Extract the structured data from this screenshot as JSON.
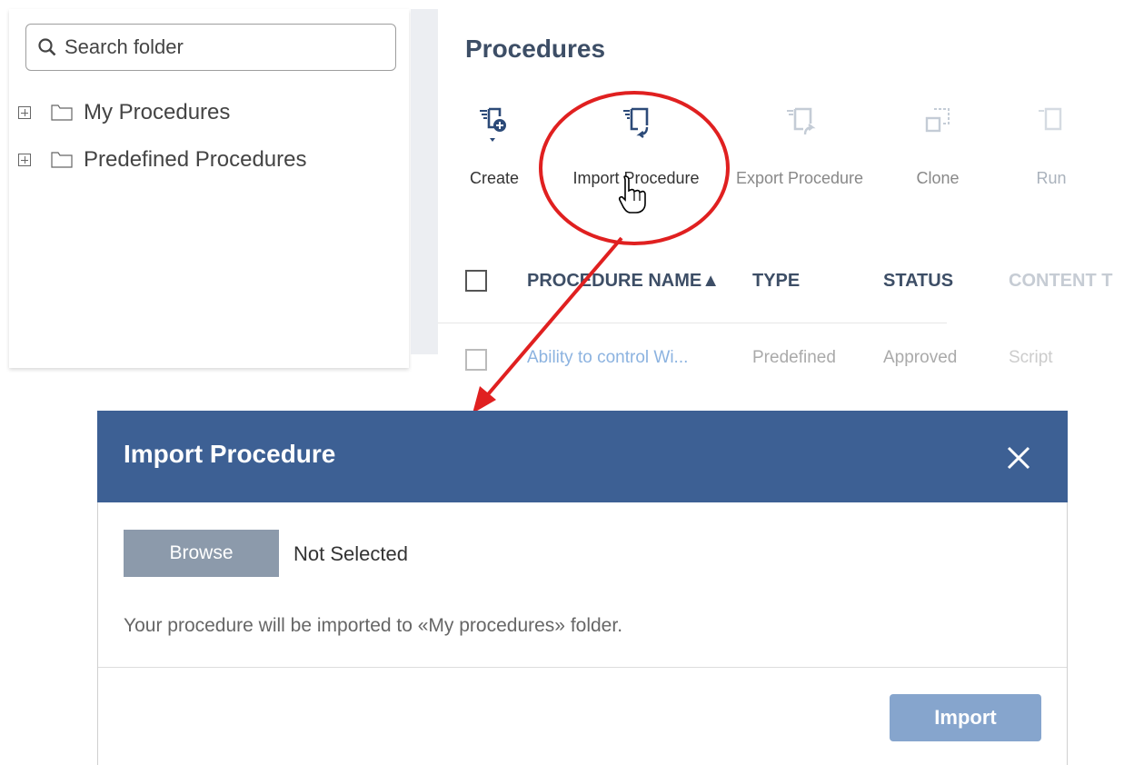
{
  "sidebar": {
    "search_placeholder": "Search folder",
    "tree": [
      {
        "label": "My Procedures"
      },
      {
        "label": "Predefined Procedures"
      }
    ]
  },
  "main": {
    "title": "Procedures",
    "toolbar": {
      "create": "Create",
      "import": "Import Procedure",
      "export": "Export Procedure",
      "clone": "Clone",
      "run": "Run"
    },
    "table": {
      "headers": {
        "name": "PROCEDURE NAME▲",
        "type": "TYPE",
        "status": "STATUS",
        "content_type": "CONTENT T"
      },
      "rows": [
        {
          "name": "Ability to control Wi...",
          "type": "Predefined",
          "status": "Approved",
          "content_type": "Script"
        }
      ]
    }
  },
  "dialog": {
    "title": "Import Procedure",
    "browse_label": "Browse",
    "file_status": "Not Selected",
    "info": "Your procedure will be imported to «My procedures» folder.",
    "import_label": "Import"
  },
  "colors": {
    "header_bg": "#3d6094",
    "accent_annotation": "#e02020",
    "title_text": "#3d4e66",
    "icon_blue": "#2c4a78"
  }
}
